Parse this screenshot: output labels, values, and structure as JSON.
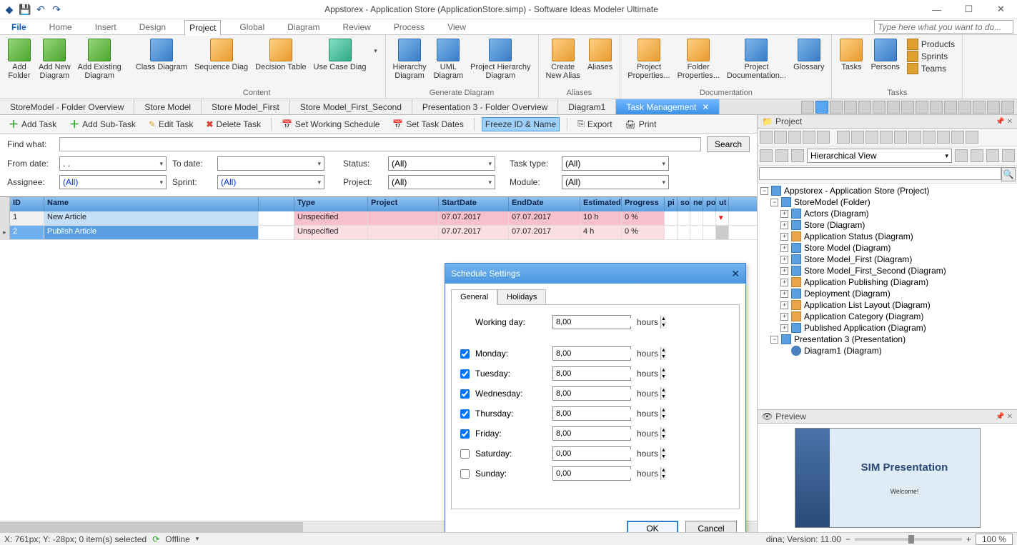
{
  "title": "Appstorex - Application Store (ApplicationStore.simp)  - Software Ideas Modeler Ultimate",
  "search_placeholder": "Type here what you want to do...",
  "menus": {
    "file": "File",
    "home": "Home",
    "insert": "Insert",
    "design": "Design",
    "project": "Project",
    "global": "Global",
    "diagram": "Diagram",
    "review": "Review",
    "process": "Process",
    "view": "View"
  },
  "ribbon": {
    "g1": {
      "add_folder": "Add\nFolder",
      "add_new_diagram": "Add New\nDiagram",
      "add_existing_diagram": "Add Existing\nDiagram"
    },
    "content": {
      "label": "Content",
      "class_diagram": "Class Diagram",
      "sequence_diag": "Sequence Diag",
      "decision_table": "Decision Table",
      "use_case_diag": "Use Case Diag"
    },
    "generate": {
      "label": "Generate Diagram",
      "hierarchy_diagram": "Hierarchy\nDiagram",
      "uml_diagram": "UML\nDiagram",
      "project_hierarchy_diagram": "Project Hierarchy\nDiagram"
    },
    "aliases": {
      "label": "Aliases",
      "create_new_alias": "Create\nNew Alias",
      "aliases": "Aliases"
    },
    "documentation": {
      "label": "Documentation",
      "project_properties": "Project\nProperties...",
      "folder_properties": "Folder\nProperties...",
      "project_documentation": "Project\nDocumentation...",
      "glossary": "Glossary"
    },
    "tasks": {
      "label": "Tasks",
      "tasks": "Tasks",
      "persons": "Persons",
      "products": "Products",
      "sprints": "Sprints",
      "teams": "Teams"
    }
  },
  "tabs": [
    "StoreModel - Folder Overview",
    "Store Model",
    "Store Model_First",
    "Store Model_First_Second",
    "Presentation 3 - Folder Overview",
    "Diagram1",
    "Task Management"
  ],
  "active_tab": "Task Management",
  "task_toolbar": {
    "add_task": "Add Task",
    "add_sub_task": "Add Sub-Task",
    "edit_task": "Edit Task",
    "delete_task": "Delete Task",
    "set_working_schedule": "Set Working Schedule",
    "set_task_dates": "Set Task Dates",
    "freeze": "Freeze ID & Name",
    "export": "Export",
    "print": "Print"
  },
  "filters": {
    "find_what": "Find what:",
    "search": "Search",
    "from_date": "From date:",
    "from_date_val": ".   .",
    "to_date": "To date:",
    "to_date_val": "",
    "status": "Status:",
    "status_val": "(All)",
    "task_type": "Task type:",
    "task_type_val": "(All)",
    "assignee": "Assignee:",
    "assignee_val": "(All)",
    "sprint": "Sprint:",
    "sprint_val": "(All)",
    "project": "Project:",
    "project_val": "(All)",
    "module": "Module:",
    "module_val": "(All)"
  },
  "columns": {
    "id": "ID",
    "name": "Name",
    "type": "Type",
    "project": "Project",
    "start": "StartDate",
    "end": "EndDate",
    "est": "Estimated",
    "prog": "Progress",
    "pi": "pi",
    "so": "so",
    "ne": "ne",
    "po": "po",
    "ut": "ut"
  },
  "rows": [
    {
      "id": "1",
      "name": "New Article",
      "type": "Unspecified",
      "project": "",
      "start": "07.07.2017",
      "end": "07.07.2017",
      "est": "10 h",
      "prog": "0 %"
    },
    {
      "id": "2",
      "name": "Publish Article",
      "type": "Unspecified",
      "project": "",
      "start": "07.07.2017",
      "end": "07.07.2017",
      "est": "4 h",
      "prog": "0 %"
    }
  ],
  "project_panel": {
    "title": "Project",
    "view": "Hierarchical View",
    "root": "Appstorex - Application Store (Project)",
    "folder": "StoreModel (Folder)",
    "items": [
      "Actors (Diagram)",
      "Store (Diagram)",
      "Application Status (Diagram)",
      "Store Model (Diagram)",
      "Store Model_First (Diagram)",
      "Store Model_First_Second (Diagram)",
      "Application Publishing (Diagram)",
      "Deployment (Diagram)",
      "Application List Layout (Diagram)",
      "Application Category (Diagram)",
      "Published Application (Diagram)"
    ],
    "presentation": "Presentation 3 (Presentation)",
    "pres_child": "Diagram1 (Diagram)"
  },
  "preview": {
    "title": "Preview",
    "slide_title": "SIM Presentation",
    "slide_sub": "Welcome!"
  },
  "dialog": {
    "title": "Schedule Settings",
    "tabs": {
      "general": "General",
      "holidays": "Holidays"
    },
    "working_day": "Working day:",
    "hours": "hours",
    "days": [
      {
        "name": "Monday:",
        "checked": true,
        "value": "8,00"
      },
      {
        "name": "Tuesday:",
        "checked": true,
        "value": "8,00"
      },
      {
        "name": "Wednesday:",
        "checked": true,
        "value": "8,00"
      },
      {
        "name": "Thursday:",
        "checked": true,
        "value": "8,00"
      },
      {
        "name": "Friday:",
        "checked": true,
        "value": "8,00"
      },
      {
        "name": "Saturday:",
        "checked": false,
        "value": "0,00"
      },
      {
        "name": "Sunday:",
        "checked": false,
        "value": "0,00"
      }
    ],
    "working_day_value": "8,00",
    "ok": "OK",
    "cancel": "Cancel"
  },
  "status": {
    "pos": "X: 761px; Y: -28px; 0 item(s) selected",
    "offline": "Offline",
    "version": "dina; Version: 11.00",
    "zoom": "100 %"
  }
}
